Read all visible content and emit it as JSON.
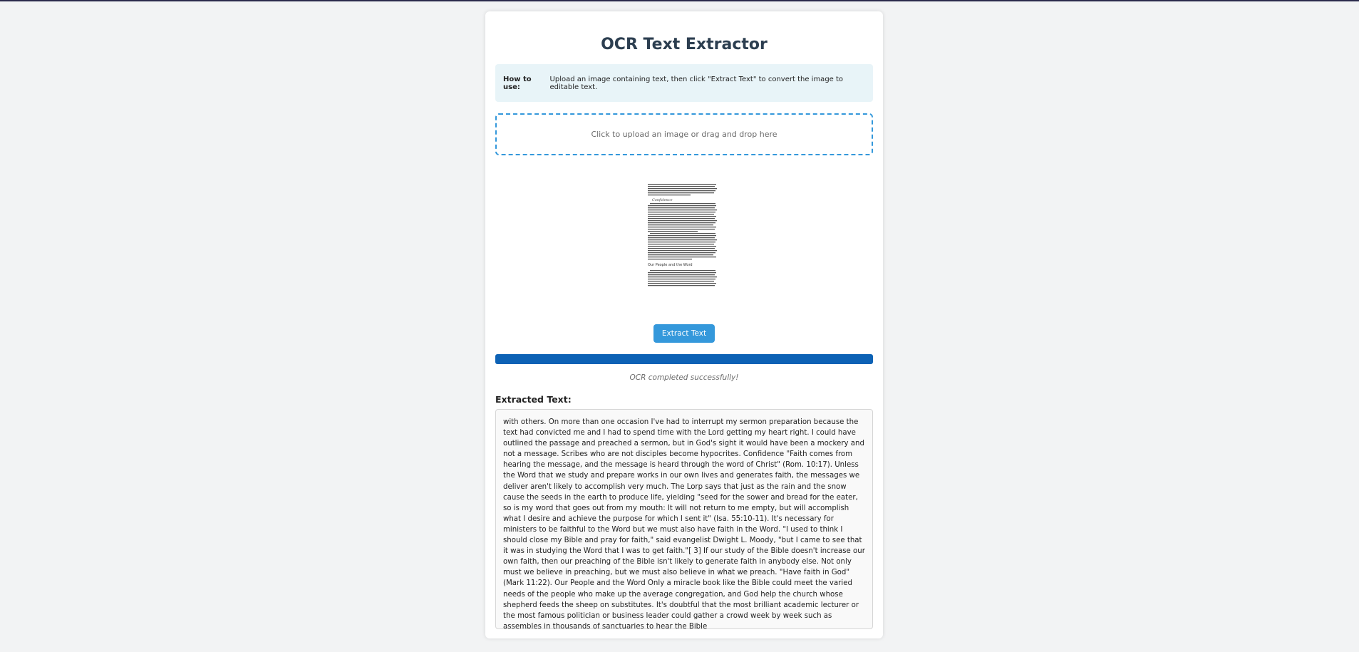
{
  "app": {
    "title": "OCR Text Extractor"
  },
  "info": {
    "label": "How to use:",
    "text": "Upload an image containing text, then click \"Extract Text\" to convert the image to editable text."
  },
  "upload": {
    "prompt": "Click to upload an image or drag and drop here"
  },
  "preview": {
    "heading_confidence": "Confidence",
    "heading_people": "Our People and the Word"
  },
  "actions": {
    "extract_label": "Extract Text"
  },
  "progress": {
    "value_percent": 100,
    "fill_color": "#0d62b5"
  },
  "status": {
    "message": "OCR completed successfully!"
  },
  "output": {
    "label": "Extracted Text:",
    "text": "with others. On more than one occasion I've had to interrupt my sermon preparation because the text had convicted me and I had to spend time with the Lord getting my heart right. I could have outlined the passage and preached a sermon, but in God's sight it would have been a mockery and not a message. Scribes who are not disciples become hypocrites. Confidence \"Faith comes from hearing the message, and the message is heard through the word of Christ\" (Rom. 10:17). Unless the Word that we study and prepare works in our own lives and generates faith, the messages we deliver aren't likely to accomplish very much. The Lorp says that just as the rain and the snow cause the seeds in the earth to produce life, yielding \"seed for the sower and bread for the eater, so is my word that goes out from my mouth: It will not return to me empty, but will accomplish what I desire and achieve the purpose for which I sent it\" (Isa. 55:10-11). It's necessary for ministers to be faithful to the Word but we must also have faith in the Word. \"I used to think I should close my Bible and pray for faith,\" said evangelist Dwight L. Moody, \"but I came to see that it was in studying the Word that I was to get faith.\"[ 3] If our study of the Bible doesn't increase our own faith, then our preaching of the Bible isn't likely to generate faith in anybody else. Not only must we believe in preaching, but we must also believe in what we preach. \"Have faith in God\" (Mark 11:22). Our People and the Word Only a miracle book like the Bible could meet the varied needs of the people who make up the average congregation, and God help the church whose shepherd feeds the sheep on substitutes. It's doubtful that the most brilliant academic lecturer or the most famous politician or business leader could gather a crowd week by week such as assembles in thousands of sanctuaries to hear the Bible"
  }
}
